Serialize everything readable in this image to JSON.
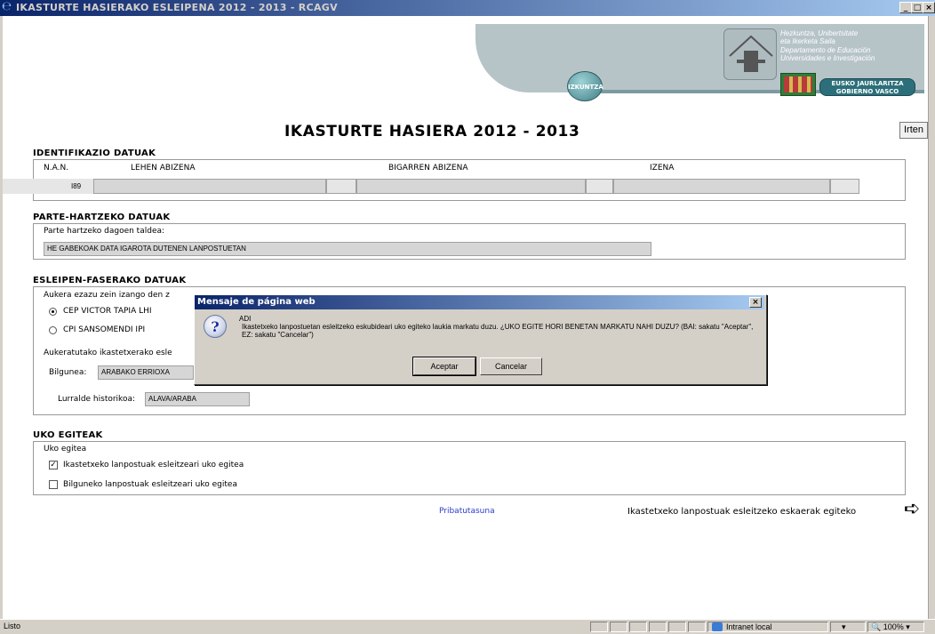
{
  "window": {
    "title": "IKASTURTE HASIERAKO ESLEIPENA 2012 - 2013 - RCAGV",
    "min_btn": "_",
    "max_btn": "□",
    "close_btn": "×"
  },
  "header": {
    "izkuntza_badge": "IZKUNTZA",
    "inst_line1": "Hezkuntza, Unibertsitate",
    "inst_line2": "eta Ikerketa Saila",
    "inst_line3": "Departamento de Educación",
    "inst_line4": "Universidades e Investigación",
    "gov_line1": "EUSKO JAURLARITZA",
    "gov_line2": "GOBIERNO VASCO"
  },
  "page": {
    "title": "IKASTURTE HASIERA 2012 - 2013",
    "exit_button": "Irten"
  },
  "identification": {
    "heading": "IDENTIFIKAZIO DATUAK",
    "col_nan": "N.A.N.",
    "col_surname1": "LEHEN ABIZENA",
    "col_surname2": "BIGARREN ABIZENA",
    "col_name": "IZENA",
    "nan_value": "I89"
  },
  "participation": {
    "heading": "PARTE-HARTZEKO DATUAK",
    "group_label": "Parte hartzeko dagoen taldea:",
    "group_value": "HE GABEKOAK DATA IGAROTA DUTENEN LANPOSTUETAN"
  },
  "assignment": {
    "heading": "ESLEIPEN-FASERAKO DATUAK",
    "choose_label": "Aukera ezazu zein izango den z",
    "option1": "CEP VICTOR TAPIA LHI",
    "option2": "CPI SANSOMENDI IPI",
    "selected_label": "Aukeratutako ikastetxerako esle",
    "bilgunea_label": "Bilgunea:",
    "bilgunea_value": "ARABAKO ERRIOXA",
    "lurralde_label": "Lurralde historikoa:",
    "lurralde_value": "ALAVA/ARABA"
  },
  "waiver": {
    "heading": "UKO EGITEAK",
    "sub_label": "Uko egitea",
    "check1": "Ikastetxeko lanpostuak esleitzeari uko egitea",
    "check1_checked": true,
    "check1_mark": "✓",
    "check2": "Bilguneko lanpostuak esleitzeari uko egitea",
    "check2_checked": false
  },
  "footer": {
    "privacy_link": "Pribatutasuna",
    "next_text": "Ikastetxeko lanpostuak esleitzeko eskaerak egiteko",
    "next_icon": "➪"
  },
  "dialog": {
    "title": "Mensaje de página web",
    "close": "×",
    "icon": "?",
    "heading": "ADI",
    "message": "Ikastetxeko lanpostuetan esleitzeko eskubideari uko egiteko laukia markatu duzu. ¿UKO EGITE HORI BENETAN MARKATU NAHI DUZU? (BAI: sakatu \"Aceptar\", EZ: sakatu \"Cancelar\")",
    "ok": "Aceptar",
    "cancel": "Cancelar"
  },
  "statusbar": {
    "status": "Listo",
    "zone": "Intranet local",
    "zoom": "100%",
    "zoom_icon": "🔍"
  },
  "colors": {
    "titlebar": "#0a246a",
    "link": "#2a3bcc",
    "banner": "#b6c4c8",
    "field_bg": "#d6d6d6"
  }
}
